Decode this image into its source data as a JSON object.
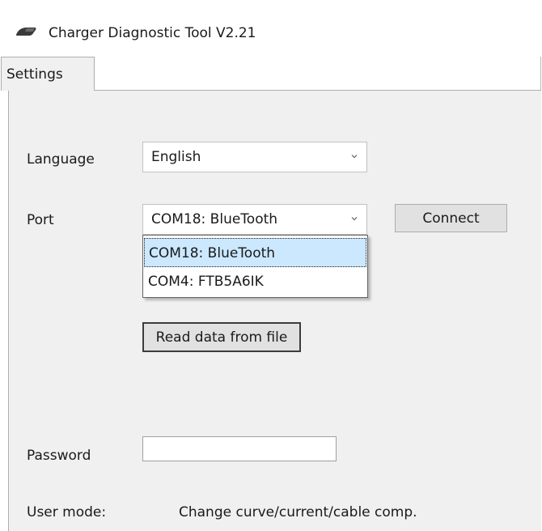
{
  "window": {
    "title": "Charger Diagnostic Tool V2.21",
    "icon": "charger-plug-icon"
  },
  "tabs": [
    {
      "label": "Settings",
      "active": true
    }
  ],
  "settings": {
    "language": {
      "label": "Language",
      "value": "English"
    },
    "port": {
      "label": "Port",
      "value": "COM18: BlueTooth",
      "options": [
        "COM18: BlueTooth",
        "COM4: FTB5A6IK"
      ],
      "dropdown_open": true,
      "highlighted": "COM18: BlueTooth"
    },
    "connect_label": "Connect",
    "read_file_label": "Read data from file",
    "password": {
      "label": "Password",
      "value": ""
    },
    "user_mode": {
      "label": "User mode:",
      "value": "Change curve/current/cable comp."
    }
  },
  "colors": {
    "panel": "#f0f0f0",
    "button": "#e1e1e1",
    "selection": "#cce8ff",
    "border": "#adadad"
  }
}
